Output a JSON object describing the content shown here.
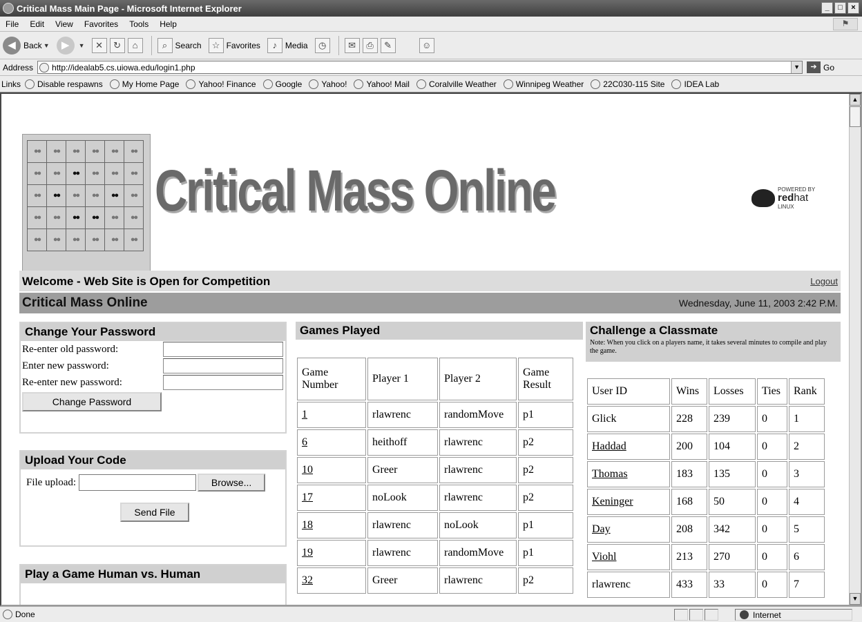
{
  "window": {
    "title": "Critical Mass Main Page - Microsoft Internet Explorer"
  },
  "menu": [
    "File",
    "Edit",
    "View",
    "Favorites",
    "Tools",
    "Help"
  ],
  "toolbar": {
    "back": "Back",
    "search": "Search",
    "favorites": "Favorites",
    "media": "Media"
  },
  "address": {
    "label": "Address",
    "url": "http://idealab5.cs.uiowa.edu/login1.php",
    "go": "Go"
  },
  "links": {
    "label": "Links",
    "items": [
      "Disable respawns",
      "My Home Page",
      "Yahoo! Finance",
      "Google",
      "Yahoo!",
      "Yahoo! Mail",
      "Coralville Weather",
      "Winnipeg Weather",
      "22C030-115 Site",
      "IDEA Lab"
    ]
  },
  "banner": {
    "title": "Critical Mass Online",
    "powered": "POWERED BY",
    "brand_red": "red",
    "brand_hat": "hat",
    "brand_sub": "LINUX"
  },
  "welcome": {
    "text": "Welcome - Web Site is Open for Competition",
    "logout": "Logout"
  },
  "header2": {
    "title": "Critical Mass Online",
    "date": "Wednesday, June 11, 2003 2:42 P.M."
  },
  "password": {
    "title": "Change Your Password",
    "old_label": "Re-enter old password:",
    "new_label": "Enter new password:",
    "confirm_label": "Re-enter new password:",
    "button": "Change Password"
  },
  "upload": {
    "title": "Upload Your Code",
    "label": "File upload:",
    "browse": "Browse...",
    "send": "Send File"
  },
  "play": {
    "title": "Play a Game Human vs. Human"
  },
  "games": {
    "title": "Games Played",
    "headers": [
      "Game Number",
      "Player 1",
      "Player 2",
      "Game Result"
    ],
    "rows": [
      [
        "1",
        "rlawrenc",
        "randomMove",
        "p1"
      ],
      [
        "6",
        "heithoff",
        "rlawrenc",
        "p2"
      ],
      [
        "10",
        "Greer",
        "rlawrenc",
        "p2"
      ],
      [
        "17",
        "noLook",
        "rlawrenc",
        "p2"
      ],
      [
        "18",
        "rlawrenc",
        "noLook",
        "p1"
      ],
      [
        "19",
        "rlawrenc",
        "randomMove",
        "p1"
      ],
      [
        "32",
        "Greer",
        "rlawrenc",
        "p2"
      ]
    ]
  },
  "challenge": {
    "title": "Challenge a Classmate",
    "note": "Note: When you click on a players name, it takes several minutes to compile and play the game.",
    "headers": [
      "User ID",
      "Wins",
      "Losses",
      "Ties",
      "Rank"
    ],
    "rows": [
      [
        "Glick",
        "228",
        "239",
        "0",
        "1"
      ],
      [
        "Haddad",
        "200",
        "104",
        "0",
        "2"
      ],
      [
        "Thomas",
        "183",
        "135",
        "0",
        "3"
      ],
      [
        "Keninger",
        "168",
        "50",
        "0",
        "4"
      ],
      [
        "Day",
        "208",
        "342",
        "0",
        "5"
      ],
      [
        "Viohl",
        "213",
        "270",
        "0",
        "6"
      ],
      [
        "rlawrenc",
        "433",
        "33",
        "0",
        "7"
      ]
    ]
  },
  "status": {
    "text": "Done",
    "zone": "Internet"
  }
}
